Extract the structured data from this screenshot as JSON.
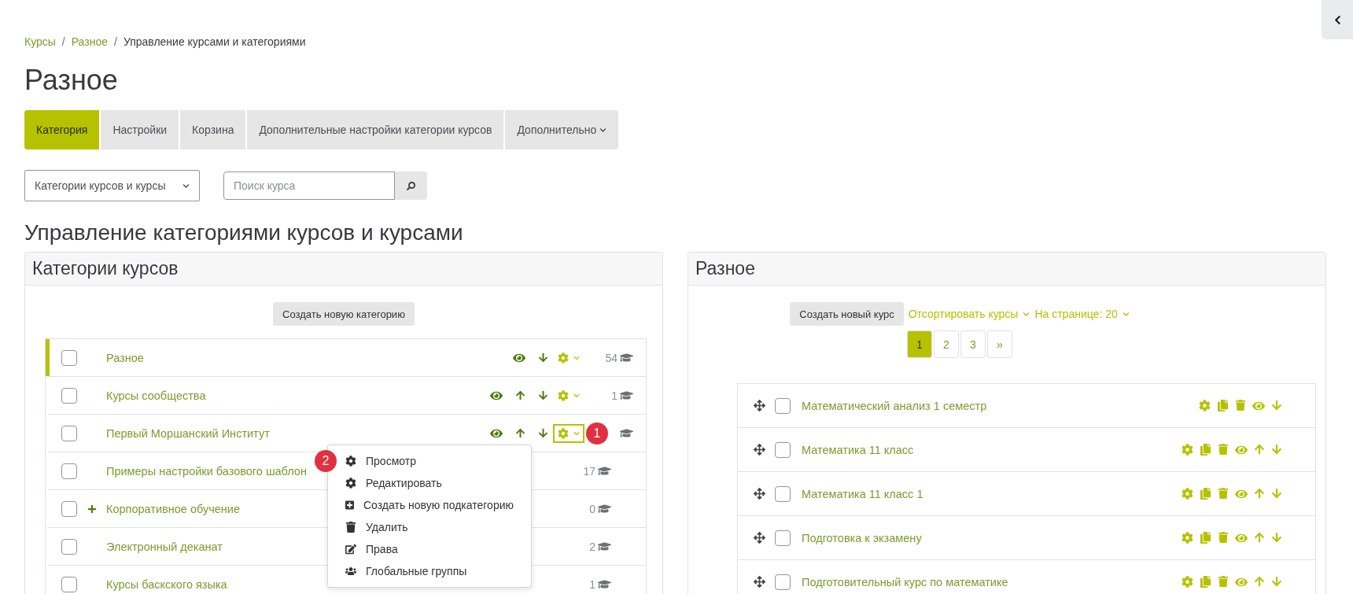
{
  "breadcrumb_separator": "/",
  "breadcrumb": [
    {
      "label": "Курсы",
      "link": true
    },
    {
      "label": "Разное",
      "link": true
    },
    {
      "label": "Управление курсами и категориями",
      "link": false
    }
  ],
  "title": "Разное",
  "tabs": [
    {
      "label": "Категория",
      "selected": true,
      "dropdown": false
    },
    {
      "label": "Настройки",
      "selected": false,
      "dropdown": false
    },
    {
      "label": "Корзина",
      "selected": false,
      "dropdown": false
    },
    {
      "label": "Дополнительные настройки категории курсов",
      "selected": false,
      "dropdown": false
    },
    {
      "label": "Дополнительно",
      "selected": false,
      "dropdown": true
    }
  ],
  "view_select": {
    "value": "Категории курсов и курсы"
  },
  "search": {
    "placeholder": "Поиск курса"
  },
  "section_heading": "Управление категориями курсов и курсами",
  "categories_panel": {
    "title": "Категории курсов",
    "create_button": "Создать новую категорию",
    "rows": [
      {
        "name": "Разное",
        "selected": true,
        "checked": false,
        "expandable": false,
        "count": "54",
        "actions": {
          "up": false,
          "focused": false
        }
      },
      {
        "name": "Курсы сообщества",
        "selected": false,
        "checked": false,
        "expandable": false,
        "count": "1",
        "actions": {
          "up": true,
          "focused": false
        }
      },
      {
        "name": "Первый Моршанский Институт",
        "selected": false,
        "checked": false,
        "expandable": false,
        "badge": "1",
        "actions": {
          "up": true,
          "focused": true
        },
        "menu_badge": "2",
        "menu": [
          {
            "label": "Просмотр",
            "kind": "view"
          },
          {
            "label": "Редактировать",
            "kind": "edit"
          },
          {
            "label": "Создать новую подкатегорию",
            "kind": "add"
          },
          {
            "label": "Удалить",
            "kind": "delete"
          },
          {
            "label": "Права",
            "kind": "permissions"
          },
          {
            "label": "Глобальные группы",
            "kind": "groups"
          }
        ]
      },
      {
        "name": "Примеры настройки базового шаблон",
        "selected": false,
        "checked": false,
        "expandable": false,
        "count": "17"
      },
      {
        "name": "Корпоративное обучение",
        "selected": false,
        "checked": false,
        "expandable": true,
        "count": "0"
      },
      {
        "name": "Электронный деканат",
        "selected": false,
        "checked": false,
        "expandable": false,
        "count": "2"
      },
      {
        "name": "Курсы баскского языка",
        "selected": false,
        "checked": false,
        "expandable": false,
        "count": "1"
      }
    ]
  },
  "courses_panel": {
    "title": "Разное",
    "create_button": "Создать новый курс",
    "sort_link": "Отсортировать курсы",
    "per_page_link": "На странице: 20",
    "pages": [
      {
        "label": "1",
        "selected": true
      },
      {
        "label": "2",
        "selected": false
      },
      {
        "label": "3",
        "selected": false
      },
      {
        "label": "»",
        "selected": false
      }
    ],
    "rows": [
      {
        "name": "Математический анализ 1 семестр",
        "checked": false,
        "up": false
      },
      {
        "name": "Математика 11 класс",
        "checked": false,
        "up": true
      },
      {
        "name": "Математика 11 класс 1",
        "checked": false,
        "up": true
      },
      {
        "name": "Подготовка к экзамену",
        "checked": false,
        "up": true
      },
      {
        "name": "Подготовительный курс по математике",
        "checked": false,
        "up": true
      }
    ]
  }
}
